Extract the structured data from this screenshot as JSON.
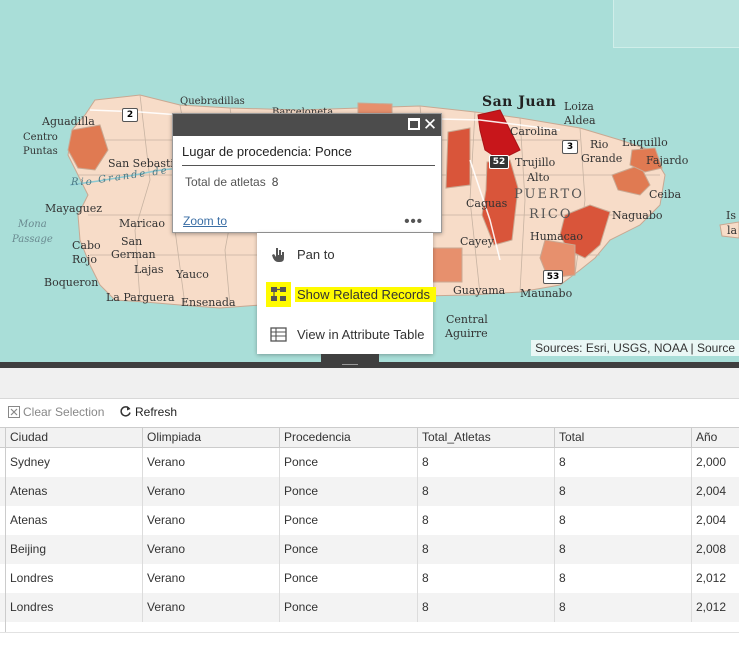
{
  "map": {
    "labels": {
      "san_juan": "San Juan",
      "loiza": "Loiza",
      "aldea": "Aldea",
      "carolina": "Carolina",
      "trujillo": "Trujillo",
      "alto": "Alto",
      "rio_grande": "Rio",
      "rio_grande_2": "Grande",
      "luquillo": "Luquillo",
      "fajardo": "Fajardo",
      "ceiba": "Ceiba",
      "naguabo": "Naguabo",
      "humacao": "Humacao",
      "caguas": "Caguas",
      "cayey": "Cayey",
      "guayama": "Guayama",
      "maunabo": "Maunabo",
      "central_aguirre_1": "Central",
      "central_aguirre_2": "Aguirre",
      "puerto": "PUERTO",
      "rico": "RICO",
      "aguadilla": "Aguadilla",
      "centro": "Centro",
      "puntas": "Puntas",
      "quebradillas": "Quebradillas",
      "barceloneta": "Barceloneta",
      "san_sebastian": "San Sebastian",
      "rio_word": "Rio",
      "grande_de": "Grande de",
      "mayaguez": "Mayaguez",
      "maricao": "Maricao",
      "cabo": "Cabo",
      "rojo": "Rojo",
      "san": "San",
      "german": "German",
      "lajas": "Lajas",
      "yauco": "Yauco",
      "boqueron": "Boqueron",
      "la_parguera": "La Parguera",
      "ensenada": "Ensenada",
      "mona": "Mona",
      "passage": "Passage",
      "is": "Is",
      "la": "la"
    },
    "shields": {
      "r2": "2",
      "r52": "52",
      "r3": "3",
      "r53": "53"
    },
    "attribution": "Sources: Esri, USGS, NOAA | Source"
  },
  "popup": {
    "title": "Lugar de procedencia: Ponce",
    "field_label": "Total de atletas",
    "field_value": "8",
    "zoom_link": "Zoom to",
    "more_icon": "•••"
  },
  "menu": {
    "items": [
      {
        "label": "Pan to",
        "icon": "pan-icon"
      },
      {
        "label": "Show Related Records",
        "icon": "related-records-icon",
        "highlighted": true,
        "highlight_color": "#fffb00"
      },
      {
        "label": "View in Attribute Table",
        "icon": "table-icon"
      }
    ]
  },
  "toolbar": {
    "clear_selection": "Clear Selection",
    "refresh": "Refresh"
  },
  "table": {
    "columns": [
      "Ciudad",
      "Olimpiada",
      "Procedencia",
      "Total_Atletas",
      "Total",
      "Año"
    ],
    "rows": [
      [
        "Sydney",
        "Verano",
        "Ponce",
        "8",
        "8",
        "2,000"
      ],
      [
        "Atenas",
        "Verano",
        "Ponce",
        "8",
        "8",
        "2,004"
      ],
      [
        "Atenas",
        "Verano",
        "Ponce",
        "8",
        "8",
        "2,004"
      ],
      [
        "Beijing",
        "Verano",
        "Ponce",
        "8",
        "8",
        "2,008"
      ],
      [
        "Londres",
        "Verano",
        "Ponce",
        "8",
        "8",
        "2,012"
      ],
      [
        "Londres",
        "Verano",
        "Ponce",
        "8",
        "8",
        "2,012"
      ]
    ]
  },
  "colors": {
    "water": "#a9ded8",
    "land": "#f7dcc8",
    "choropleth_dark": "#c8161b",
    "choropleth_mid": "#d9553a",
    "choropleth_light": "#e7906d",
    "popup_header": "#4c4c4c",
    "highlight": "#fffb00"
  }
}
